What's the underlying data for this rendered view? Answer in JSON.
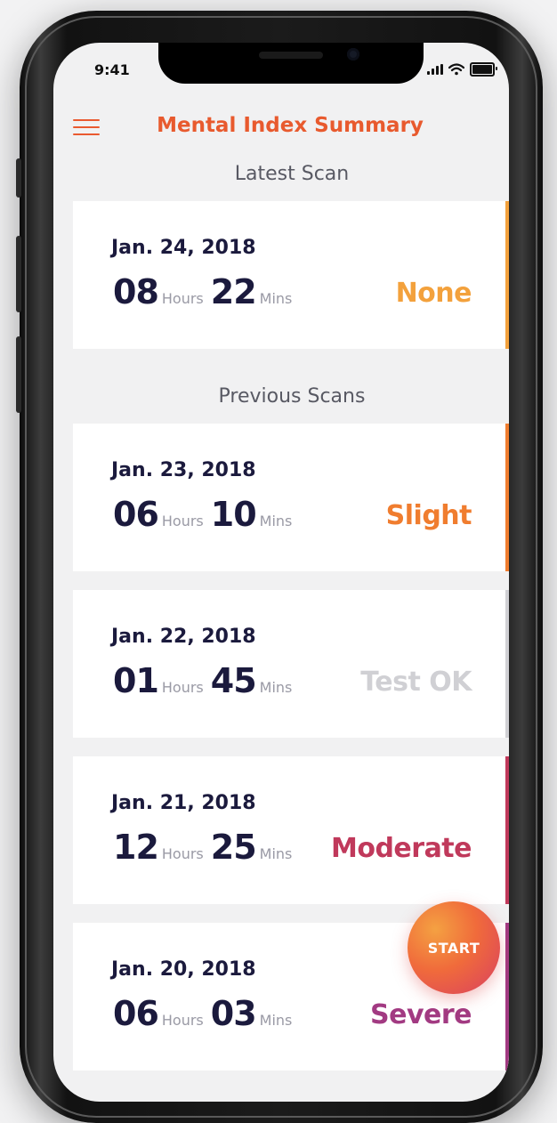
{
  "status_bar": {
    "time": "9:41"
  },
  "header": {
    "title": "Mental Index Summary"
  },
  "latest": {
    "heading": "Latest Scan",
    "scan": {
      "date": "Jan. 24, 2018",
      "hours": "08",
      "hours_unit": "Hours",
      "mins": "22",
      "mins_unit": "Mins",
      "status": "None",
      "color": "#f3a13c"
    }
  },
  "previous": {
    "heading": "Previous Scans",
    "scans": [
      {
        "date": "Jan. 23, 2018",
        "hours": "06",
        "hours_unit": "Hours",
        "mins": "10",
        "mins_unit": "Mins",
        "status": "Slight",
        "color": "#f07d2f"
      },
      {
        "date": "Jan. 22, 2018",
        "hours": "01",
        "hours_unit": "Hours",
        "mins": "45",
        "mins_unit": "Mins",
        "status": "Test OK",
        "color": "#d0d0d4"
      },
      {
        "date": "Jan. 21, 2018",
        "hours": "12",
        "hours_unit": "Hours",
        "mins": "25",
        "mins_unit": "Mins",
        "status": "Moderate",
        "color": "#c0395b"
      },
      {
        "date": "Jan. 20, 2018",
        "hours": "06",
        "hours_unit": "Hours",
        "mins": "03",
        "mins_unit": "Mins",
        "status": "Severe",
        "color": "#a23a82"
      }
    ]
  },
  "start_button": {
    "label": "START"
  }
}
